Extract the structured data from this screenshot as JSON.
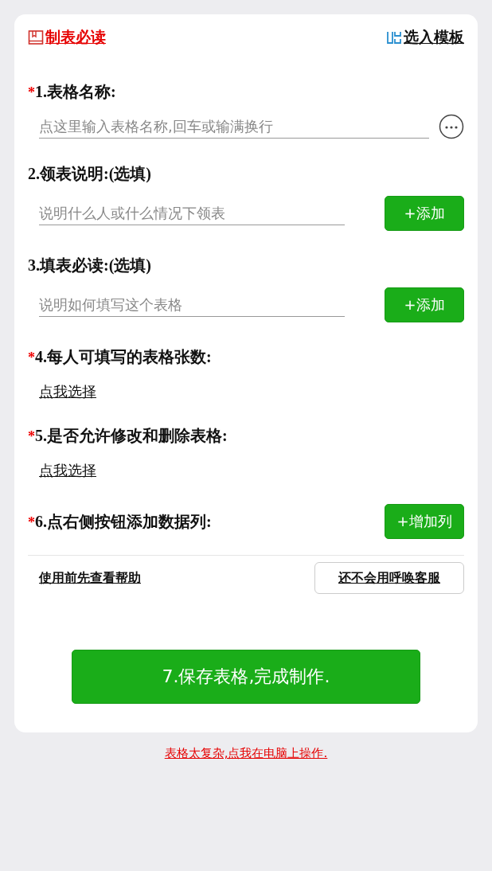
{
  "header": {
    "guide_link": "制表必读",
    "template_link": "选入模板"
  },
  "sections": [
    {
      "marker": "*",
      "label": "1.表格名称:",
      "kind": "title_input",
      "placeholder": "点这里输入表格名称,回车或输满换行"
    },
    {
      "label": "2.领表说明:(选填)",
      "kind": "input_add",
      "placeholder": "说明什么人或什么情况下领表",
      "button": "+添加"
    },
    {
      "label": "3.填表必读:(选填)",
      "kind": "input_add",
      "placeholder": "说明如何填写这个表格",
      "button": "+添加"
    },
    {
      "marker": "*",
      "label": "4.每人可填写的表格张数:",
      "kind": "choose",
      "link": "点我选择"
    },
    {
      "marker": "*",
      "label": "5.是否允许修改和删除表格:",
      "kind": "choose",
      "link": "点我选择"
    },
    {
      "marker": "*",
      "label": "6.点右侧按钮添加数据列:",
      "kind": "header_button",
      "button": "+增加列"
    }
  ],
  "help": {
    "link": "使用前先查看帮助",
    "button": "还不会用呼唤客服"
  },
  "save_button": "7.保存表格,完成制作.",
  "pc_link": "表格太复杂,点我在电脑上操作."
}
